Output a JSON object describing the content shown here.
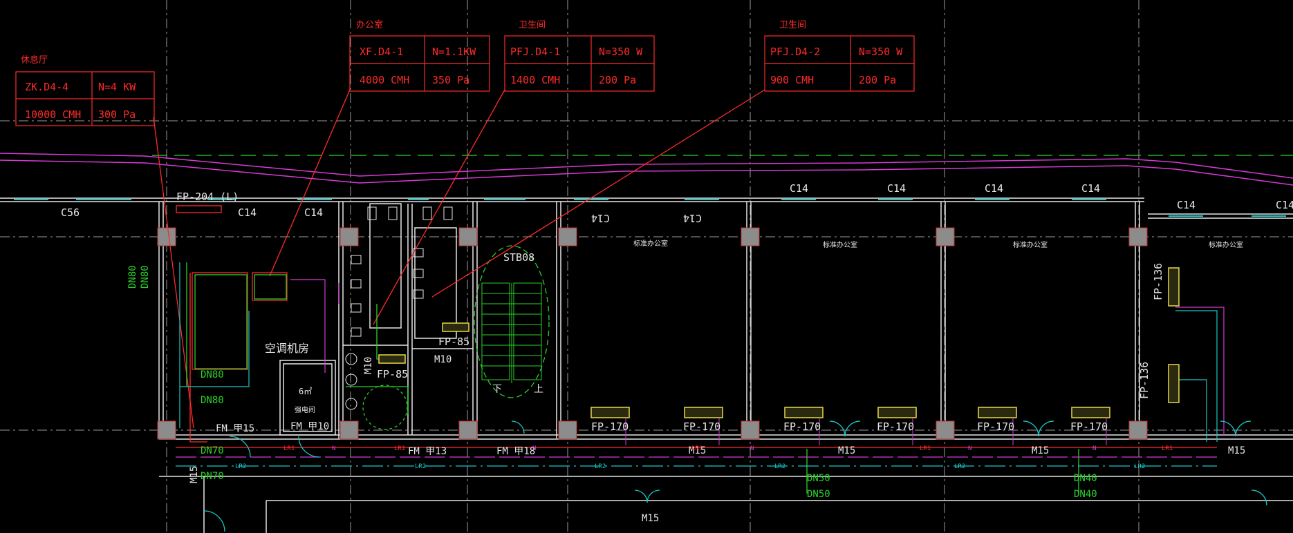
{
  "colors": {
    "background": "#000000",
    "grid": "#9a9a9a",
    "wall": "#e6e6e6",
    "equipment": "#ff2a2a",
    "pipe_green": "#2bd12b",
    "pipe_cyan": "#19c8c8",
    "duct_magenta": "#d63ad6",
    "fan_coil": "#e8d84a",
    "column": "#8c8c8c"
  },
  "equipment_tables": [
    {
      "room": "休息厅",
      "tag": "ZK.D4-4",
      "power": "N=4 KW",
      "airflow": "10000 CMH",
      "pressure": "300 Pa"
    },
    {
      "room": "办公室",
      "tag": "XF.D4-1",
      "power": "N=1.1KW",
      "airflow": "4000 CMH",
      "pressure": "350 Pa"
    },
    {
      "room": "卫生间",
      "tag": "PFJ.D4-1",
      "power": "N=350 W",
      "airflow": "1400 CMH",
      "pressure": "200 Pa"
    },
    {
      "room": "卫生间",
      "tag": "PFJ.D4-2",
      "power": "N=350 W",
      "airflow": "900 CMH",
      "pressure": "200 Pa"
    }
  ],
  "window_labels": [
    "C56",
    "C14",
    "C14",
    "C14",
    "C14",
    "C14",
    "C14",
    "C14",
    "C14",
    "C14",
    "C14"
  ],
  "mirrored_labels": [
    "C14",
    "C14"
  ],
  "fan_coil_labels": [
    "FP-170",
    "FP-170",
    "FP-170",
    "FP-170",
    "FP-170",
    "FP-170"
  ],
  "fp85_labels": [
    "FP-85",
    "FP-85"
  ],
  "fp136_labels": [
    "FP-136",
    "FP-136"
  ],
  "fp204_label": "FP-204 (L)",
  "room_names": {
    "ahu_room": "空调机房",
    "stair": "STB08",
    "stair_down": "下",
    "stair_up": "上",
    "office_rooms": [
      "标准办公室",
      "标准办公室",
      "标准办公室",
      "标准办公室"
    ],
    "small_room_area": "6㎡",
    "small_room_name": "强电间"
  },
  "door_labels": {
    "fm15": "FM 甲15",
    "fm10": "FM 甲10",
    "fm13": "FM 甲13",
    "fm18": "FM 甲18",
    "m10_a": "M10",
    "m10_b": "M10",
    "m15_a": "M15",
    "m15_b": "M15",
    "m15_c": "M15",
    "m15_d": "M15",
    "m15_bottom": "M15",
    "m15_left": "M15"
  },
  "pipe_labels": {
    "dn80_vertical_a": "DN80",
    "dn80_vertical_b": "DN80",
    "dn80_a": "DN80",
    "dn80_b": "DN80",
    "dn70_a": "DN70",
    "dn70_b": "DN70",
    "dn50_a": "DN50",
    "dn50_b": "DN50",
    "dn40_a": "DN40",
    "dn40_b": "DN40"
  },
  "line_codes": {
    "lr1": "LR1",
    "lr2": "LR2",
    "n": "N"
  }
}
